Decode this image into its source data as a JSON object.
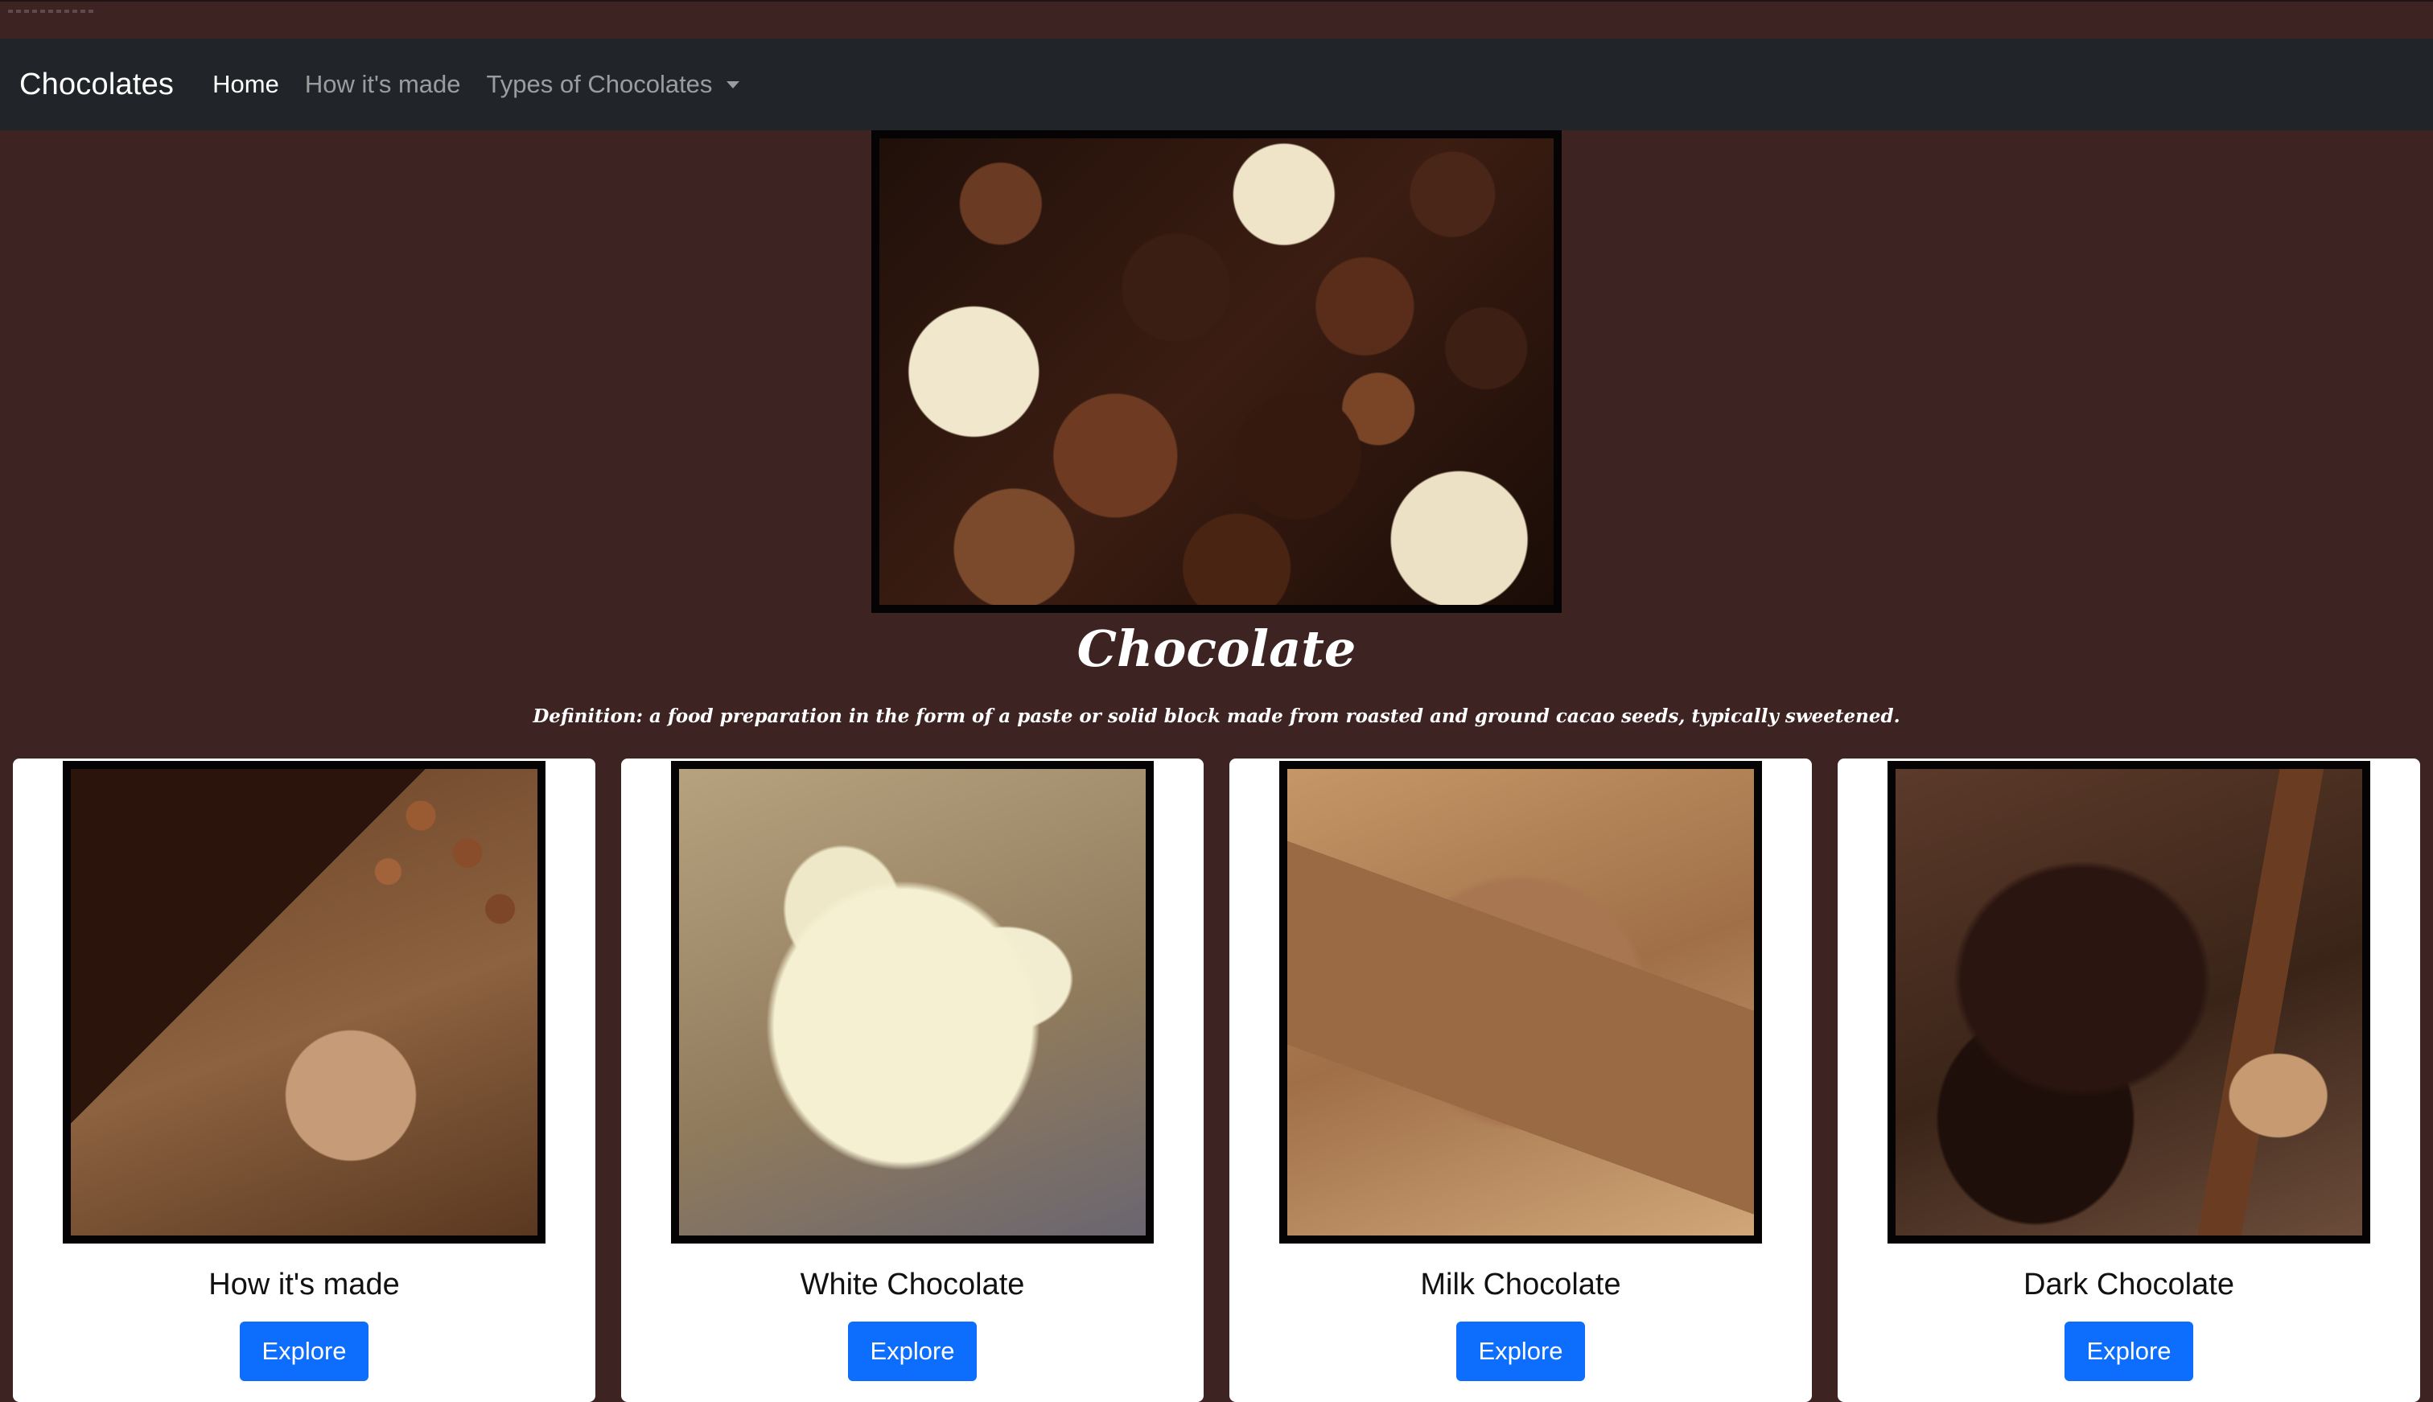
{
  "navbar": {
    "brand": "Chocolates",
    "links": [
      {
        "label": "Home",
        "active": true
      },
      {
        "label": "How it's made",
        "active": false
      },
      {
        "label": "Types of Chocolates",
        "active": false,
        "dropdown": true
      }
    ]
  },
  "hero": {
    "title": "Chocolate",
    "definition": "Definition: a food preparation in the form of a paste or solid block made from roasted and ground cacao seeds, typically sweetened."
  },
  "cards": [
    {
      "title": "How it's made",
      "button": "Explore"
    },
    {
      "title": "White Chocolate",
      "button": "Explore"
    },
    {
      "title": "Milk Chocolate",
      "button": "Explore"
    },
    {
      "title": "Dark Chocolate",
      "button": "Explore"
    }
  ],
  "colors": {
    "page_background": "#3d2322",
    "navbar_background": "#212529",
    "button_primary": "#0d6efd"
  }
}
